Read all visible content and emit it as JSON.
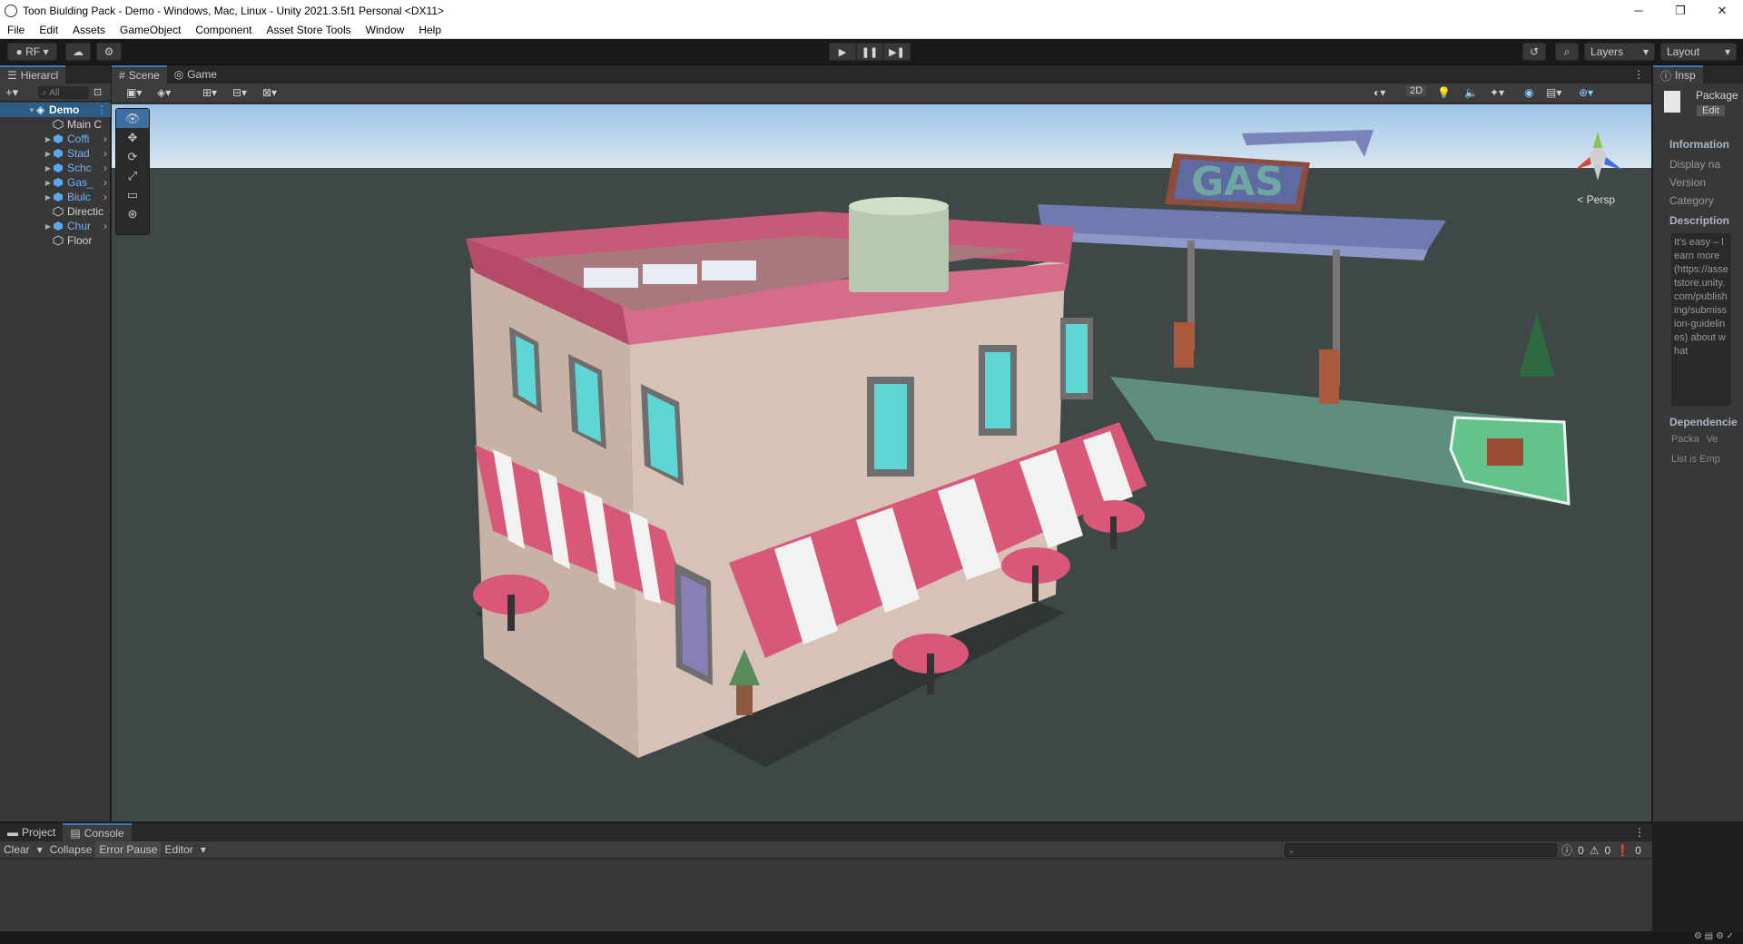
{
  "window": {
    "title": "Toon Biulding Pack - Demo - Windows, Mac, Linux - Unity 2021.3.5f1 Personal <DX11>",
    "controls": [
      "─",
      "❐",
      "✕"
    ]
  },
  "menubar": [
    "File",
    "Edit",
    "Assets",
    "GameObject",
    "Component",
    "Asset Store Tools",
    "Window",
    "Help"
  ],
  "toolbar": {
    "account_label": "RF",
    "layers_label": "Layers",
    "layout_label": "Layout",
    "play_buttons": [
      "▶",
      "❚❚",
      "▶❚"
    ]
  },
  "hierarchy": {
    "tab_label": "Hierarcl",
    "search_placeholder": "All",
    "root": "Demo",
    "items": [
      {
        "label": "Main C",
        "prefab": false,
        "expandable": false
      },
      {
        "label": "Coffi",
        "prefab": true,
        "expandable": true
      },
      {
        "label": "Stad",
        "prefab": true,
        "expandable": true
      },
      {
        "label": "Schc",
        "prefab": true,
        "expandable": true
      },
      {
        "label": "Gas_",
        "prefab": true,
        "expandable": true
      },
      {
        "label": "Biulc",
        "prefab": true,
        "expandable": true
      },
      {
        "label": "Directic",
        "prefab": false,
        "expandable": false
      },
      {
        "label": "Chur",
        "prefab": true,
        "expandable": true
      },
      {
        "label": "Floor",
        "prefab": false,
        "expandable": false
      }
    ]
  },
  "scene": {
    "tabs": [
      "Scene",
      "Game"
    ],
    "mode_2d": "2D",
    "persp_label": "< Persp",
    "gas_sign": "GAS",
    "tools": [
      "view-tool",
      "move-tool",
      "rotate-tool",
      "scale-tool",
      "rect-tool",
      "transform-tool"
    ]
  },
  "inspector": {
    "tab_label": "Insp",
    "package_label": "Package",
    "edit_label": "Edit",
    "information_header": "Information",
    "fields": [
      "Display na",
      "Version",
      "Category"
    ],
    "description_header": "Description",
    "description_text": "It's easy – learn more (https://assetstore.unity.com/publishing/submission-guidelines) about what",
    "dependencies_header": "Dependencie",
    "dep_columns": [
      "Packa",
      "Ve"
    ],
    "dep_empty": "List is Emp"
  },
  "bottom": {
    "tabs": [
      "Project",
      "Console"
    ],
    "buttons": [
      "Clear",
      "Collapse",
      "Error Pause",
      "Editor"
    ],
    "counts": {
      "info": "0",
      "warn": "0",
      "error": "0"
    }
  },
  "colors": {
    "accent": "#3a79bb",
    "selection": "#2c5d87",
    "prefab_text": "#6fb4ff",
    "roof_pink": "#c65a78",
    "wall": "#d6c2b6",
    "ground": "#3f4847"
  }
}
